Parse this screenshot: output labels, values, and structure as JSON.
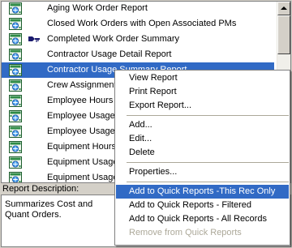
{
  "report_list": {
    "items": [
      {
        "label": "Aging Work Order Report",
        "badge": ""
      },
      {
        "label": "Closed Work Orders with Open Associated PMs",
        "badge": ""
      },
      {
        "label": "Completed Work Order Summary",
        "badge": "key-arrow-icon"
      },
      {
        "label": "Contractor Usage Detail Report",
        "badge": ""
      },
      {
        "label": "Contractor Usage Summary Report",
        "badge": ""
      },
      {
        "label": "Crew Assignment",
        "badge": ""
      },
      {
        "label": "Employee Hours b",
        "badge": ""
      },
      {
        "label": "Employee Usage",
        "badge": ""
      },
      {
        "label": "Employee Usage",
        "badge": ""
      },
      {
        "label": "Equipment Hours",
        "badge": ""
      },
      {
        "label": "Equipment Usage",
        "badge": ""
      },
      {
        "label": "Equipment Usage",
        "badge": ""
      }
    ],
    "selected_index": 4
  },
  "description": {
    "label": "Report Description:",
    "text": "Summarizes Cost and Quant Orders."
  },
  "context_menu": {
    "items": [
      {
        "label": "View Report",
        "type": "item"
      },
      {
        "label": "Print Report",
        "type": "item"
      },
      {
        "label": "Export Report...",
        "type": "item"
      },
      {
        "type": "separator"
      },
      {
        "label": "Add...",
        "type": "item"
      },
      {
        "label": "Edit...",
        "type": "item"
      },
      {
        "label": "Delete",
        "type": "item"
      },
      {
        "type": "separator"
      },
      {
        "label": "Properties...",
        "type": "item"
      },
      {
        "type": "separator"
      },
      {
        "label": "Add to Quick Reports -This Rec Only",
        "type": "item",
        "highlighted": true
      },
      {
        "label": "Add to Quick Reports - Filtered",
        "type": "item"
      },
      {
        "label": "Add to Quick Reports - All Records",
        "type": "item"
      },
      {
        "label": "Remove from Quick Reports",
        "type": "item",
        "disabled": true
      }
    ]
  },
  "colors": {
    "selection": "#316ac5",
    "window_bg": "#d4d0c8",
    "disabled_text": "#aca899"
  }
}
